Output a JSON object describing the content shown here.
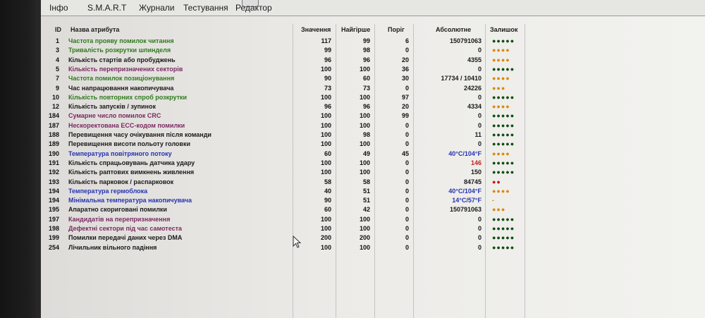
{
  "tabs": [
    {
      "label": "Інфо"
    },
    {
      "label": "S.M.A.R.T"
    },
    {
      "label": "Журнали"
    },
    {
      "label": "Тестування"
    },
    {
      "label": "Редактор"
    }
  ],
  "columns": {
    "id": "ID",
    "name": "Назва атрибута",
    "value": "Значення",
    "worst": "Найгірше",
    "threshold": "Поріг",
    "raw": "Абсолютне",
    "remaining": "Залишок"
  },
  "colors": {
    "green": "#2f7a1e",
    "purple": "#7a2a62",
    "blue": "#2633b0",
    "dark": "#1a1a1a",
    "red": "#c0241c",
    "dot_green": "#0f4d0f",
    "dot_orange": "#d98a10",
    "dot_red": "#c21a14"
  },
  "rows": [
    {
      "id": "1",
      "name": "Частота прояву помилок читання",
      "name_color": "green",
      "value": "117",
      "worst": "99",
      "threshold": "6",
      "raw": "150791063",
      "raw_color": "dark",
      "remaining": "●●●●●",
      "rem_color": "dot_green"
    },
    {
      "id": "3",
      "name": "Тривалість розкрутки шпинделя",
      "name_color": "green",
      "value": "99",
      "worst": "98",
      "threshold": "0",
      "raw": "0",
      "raw_color": "dark",
      "remaining": "●●●●",
      "rem_color": "dot_orange"
    },
    {
      "id": "4",
      "name": "Кількість стартів або пробуджень",
      "name_color": "dark",
      "value": "96",
      "worst": "96",
      "threshold": "20",
      "raw": "4355",
      "raw_color": "dark",
      "remaining": "●●●●",
      "rem_color": "dot_orange"
    },
    {
      "id": "5",
      "name": "Кількість перепризначених секторів",
      "name_color": "purple",
      "value": "100",
      "worst": "100",
      "threshold": "36",
      "raw": "0",
      "raw_color": "dark",
      "remaining": "●●●●●",
      "rem_color": "dot_green"
    },
    {
      "id": "7",
      "name": "Частота помилок позиціонування",
      "name_color": "green",
      "value": "90",
      "worst": "60",
      "threshold": "30",
      "raw": "17734 / 10410",
      "raw_color": "dark",
      "remaining": "●●●●",
      "rem_color": "dot_orange"
    },
    {
      "id": "9",
      "name": "Час напрацювання накопичувача",
      "name_color": "dark",
      "value": "73",
      "worst": "73",
      "threshold": "0",
      "raw": "24226",
      "raw_color": "dark",
      "remaining": "●●●",
      "rem_color": "dot_orange"
    },
    {
      "id": "10",
      "name": "Кількість повторних спроб розкрутки",
      "name_color": "green",
      "value": "100",
      "worst": "100",
      "threshold": "97",
      "raw": "0",
      "raw_color": "dark",
      "remaining": "●●●●●",
      "rem_color": "dot_green"
    },
    {
      "id": "12",
      "name": "Кількість запусків / зупинок",
      "name_color": "dark",
      "value": "96",
      "worst": "96",
      "threshold": "20",
      "raw": "4334",
      "raw_color": "dark",
      "remaining": "●●●●",
      "rem_color": "dot_orange"
    },
    {
      "id": "184",
      "name": "Сумарне число помилок CRC",
      "name_color": "purple",
      "value": "100",
      "worst": "100",
      "threshold": "99",
      "raw": "0",
      "raw_color": "dark",
      "remaining": "●●●●●",
      "rem_color": "dot_green"
    },
    {
      "id": "187",
      "name": "Нескоректована ECC-кодом помилки",
      "name_color": "purple",
      "value": "100",
      "worst": "100",
      "threshold": "0",
      "raw": "0",
      "raw_color": "dark",
      "remaining": "●●●●●",
      "rem_color": "dot_green"
    },
    {
      "id": "188",
      "name": "Перевищення часу очікування після команди",
      "name_color": "dark",
      "value": "100",
      "worst": "98",
      "threshold": "0",
      "raw": "11",
      "raw_color": "dark",
      "remaining": "●●●●●",
      "rem_color": "dot_green"
    },
    {
      "id": "189",
      "name": "Перевищення висоти польоту головки",
      "name_color": "dark",
      "value": "100",
      "worst": "100",
      "threshold": "0",
      "raw": "0",
      "raw_color": "dark",
      "remaining": "●●●●●",
      "rem_color": "dot_green"
    },
    {
      "id": "190",
      "name": "Температура повітряного потоку",
      "name_color": "blue",
      "value": "60",
      "worst": "49",
      "threshold": "45",
      "raw": "40°C/104°F",
      "raw_color": "blue",
      "remaining": "●●●●",
      "rem_color": "dot_orange"
    },
    {
      "id": "191",
      "name": "Кількість спрацьовувань датчика удару",
      "name_color": "dark",
      "value": "100",
      "worst": "100",
      "threshold": "0",
      "raw": "146",
      "raw_color": "red",
      "remaining": "●●●●●",
      "rem_color": "dot_green"
    },
    {
      "id": "192",
      "name": "Кількість раптових вимкнень живлення",
      "name_color": "dark",
      "value": "100",
      "worst": "100",
      "threshold": "0",
      "raw": "150",
      "raw_color": "dark",
      "remaining": "●●●●●",
      "rem_color": "dot_green"
    },
    {
      "id": "193",
      "name": "Кількість парковок / распарковок",
      "name_color": "dark",
      "value": "58",
      "worst": "58",
      "threshold": "0",
      "raw": "84745",
      "raw_color": "dark",
      "remaining": "●●",
      "rem_color": "dot_red"
    },
    {
      "id": "194",
      "name": "Температура гермоблока",
      "name_color": "blue",
      "value": "40",
      "worst": "51",
      "threshold": "0",
      "raw": "40°C/104°F",
      "raw_color": "blue",
      "remaining": "●●●●",
      "rem_color": "dot_orange"
    },
    {
      "id": "194",
      "name": "Мінімальна температура накопичувача",
      "name_color": "blue",
      "value": "90",
      "worst": "51",
      "threshold": "0",
      "raw": "14°C/57°F",
      "raw_color": "blue",
      "remaining": "-",
      "rem_color": "dot_orange"
    },
    {
      "id": "195",
      "name": "Апаратно скориговані помилки",
      "name_color": "dark",
      "value": "60",
      "worst": "42",
      "threshold": "0",
      "raw": "150791063",
      "raw_color": "dark",
      "remaining": "●●●",
      "rem_color": "dot_orange"
    },
    {
      "id": "197",
      "name": "Кандидатів на перепризначення",
      "name_color": "purple",
      "value": "100",
      "worst": "100",
      "threshold": "0",
      "raw": "0",
      "raw_color": "dark",
      "remaining": "●●●●●",
      "rem_color": "dot_green"
    },
    {
      "id": "198",
      "name": "Дефектні сектори під час самотеста",
      "name_color": "purple",
      "value": "100",
      "worst": "100",
      "threshold": "0",
      "raw": "0",
      "raw_color": "dark",
      "remaining": "●●●●●",
      "rem_color": "dot_green"
    },
    {
      "id": "199",
      "name": "Помилки передачі даних через DMA",
      "name_color": "dark",
      "value": "200",
      "worst": "200",
      "threshold": "0",
      "raw": "0",
      "raw_color": "dark",
      "remaining": "●●●●●",
      "rem_color": "dot_green"
    },
    {
      "id": "254",
      "name": "Лічильник вільного падіння",
      "name_color": "dark",
      "value": "100",
      "worst": "100",
      "threshold": "0",
      "raw": "0",
      "raw_color": "dark",
      "remaining": "●●●●●",
      "rem_color": "dot_green"
    }
  ]
}
